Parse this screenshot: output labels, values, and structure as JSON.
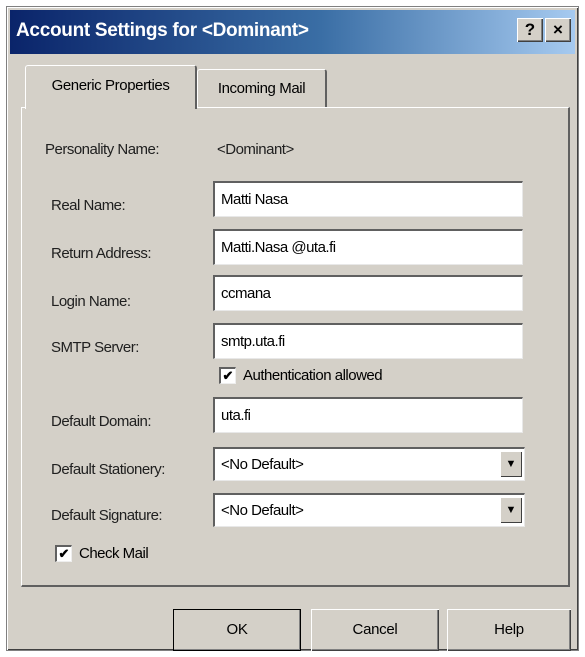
{
  "window": {
    "title": "Account Settings for <Dominant>",
    "help_label": "?",
    "close_label": "×"
  },
  "tabs": [
    {
      "label": "Generic Properties",
      "active": true
    },
    {
      "label": "Incoming Mail",
      "active": false
    }
  ],
  "form": {
    "personality_name": {
      "label": "Personality Name:",
      "value": "<Dominant>"
    },
    "real_name": {
      "label": "Real Name:",
      "value": "Matti Nasa"
    },
    "return_address": {
      "label": "Return Address:",
      "value": "Matti.Nasa @uta.fi"
    },
    "login_name": {
      "label": "Login Name:",
      "value": "ccmana"
    },
    "smtp_server": {
      "label": "SMTP Server:",
      "value": "smtp.uta.fi"
    },
    "authentication": {
      "label": "Authentication allowed",
      "checked": true
    },
    "default_domain": {
      "label": "Default Domain:",
      "value": "uta.fi"
    },
    "default_stationery": {
      "label": "Default Stationery:",
      "value": "<No Default>"
    },
    "default_signature": {
      "label": "Default Signature:",
      "value": "<No Default>"
    },
    "check_mail": {
      "label": "Check Mail",
      "checked": true
    }
  },
  "buttons": {
    "ok": "OK",
    "cancel": "Cancel",
    "help": "Help"
  },
  "icons": {
    "dropdown": "▼",
    "check": "✔"
  }
}
